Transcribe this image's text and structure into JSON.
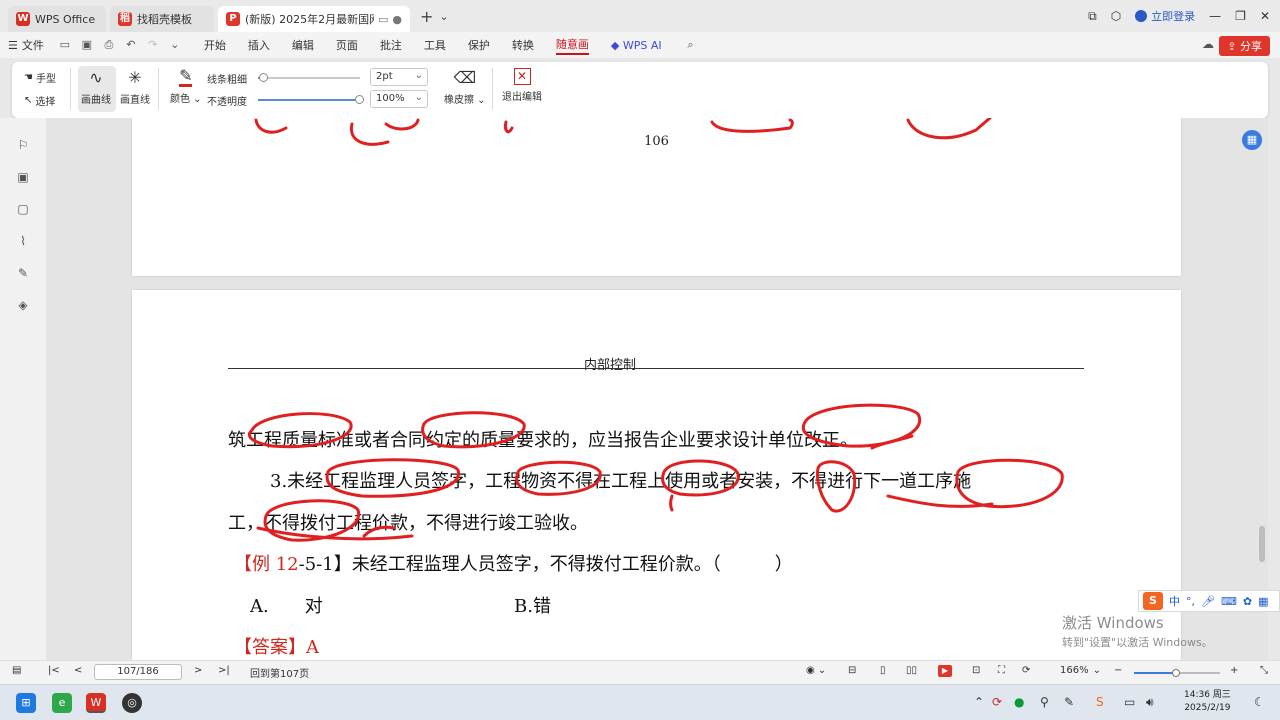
{
  "tabs": [
    {
      "label": "WPS Office",
      "icon": "wps-logo-icon"
    },
    {
      "label": "找稻壳模板",
      "icon": "docer-icon"
    },
    {
      "label": "(新版) 2025年2月最新国网",
      "icon": "pdf-icon",
      "active": true
    }
  ],
  "titlebar": {
    "login": "立即登录"
  },
  "menu": {
    "file": "文件",
    "items": [
      "开始",
      "插入",
      "编辑",
      "页面",
      "批注",
      "工具",
      "保护",
      "转换",
      "随意画",
      "WPS AI"
    ],
    "active": "随意画",
    "share": "分享"
  },
  "ribbon": {
    "hand": "手型",
    "select": "选择",
    "draw_curve": "画曲线",
    "draw_line": "画直线",
    "color": "颜色",
    "line_width_label": "线条粗细",
    "line_width_value": "2pt",
    "opacity_label": "不透明度",
    "opacity_value": "100%",
    "eraser": "橡皮擦",
    "exit": "退出编辑",
    "line_width_level": 0.06,
    "opacity_level": 1.0,
    "pen_color": "#d0261e"
  },
  "document": {
    "prev_page_number": "106",
    "header": "内部控制",
    "line1": "筑工程质量标准或者合同约定的质量要求的，应当报告企业要求设计单位改正。",
    "line2": "3.未经工程监理人员签字，工程物资不得在工程上使用或者安装，不得进行下一道工序施",
    "line3": "工，不得拨付工程价款，不得进行竣工验收。",
    "example_tag": "【例 12",
    "example_rest": "-5-1】未经工程监理人员签字，不得拨付工程价款。（　　　）",
    "option_a": "A.　　对",
    "option_b": "B.错",
    "answer_tag": "【答案】A"
  },
  "statusbar": {
    "page_box": "107/186",
    "goto": "回到第107页",
    "zoom": "166%",
    "zoom_level": 0.5
  },
  "ime": {
    "label": "中"
  },
  "watermark": {
    "line1": "激活 Windows",
    "line2": "转到\"设置\"以激活 Windows。"
  },
  "taskbar": {
    "time": "14:36 周三",
    "date": "2025/2/19"
  }
}
